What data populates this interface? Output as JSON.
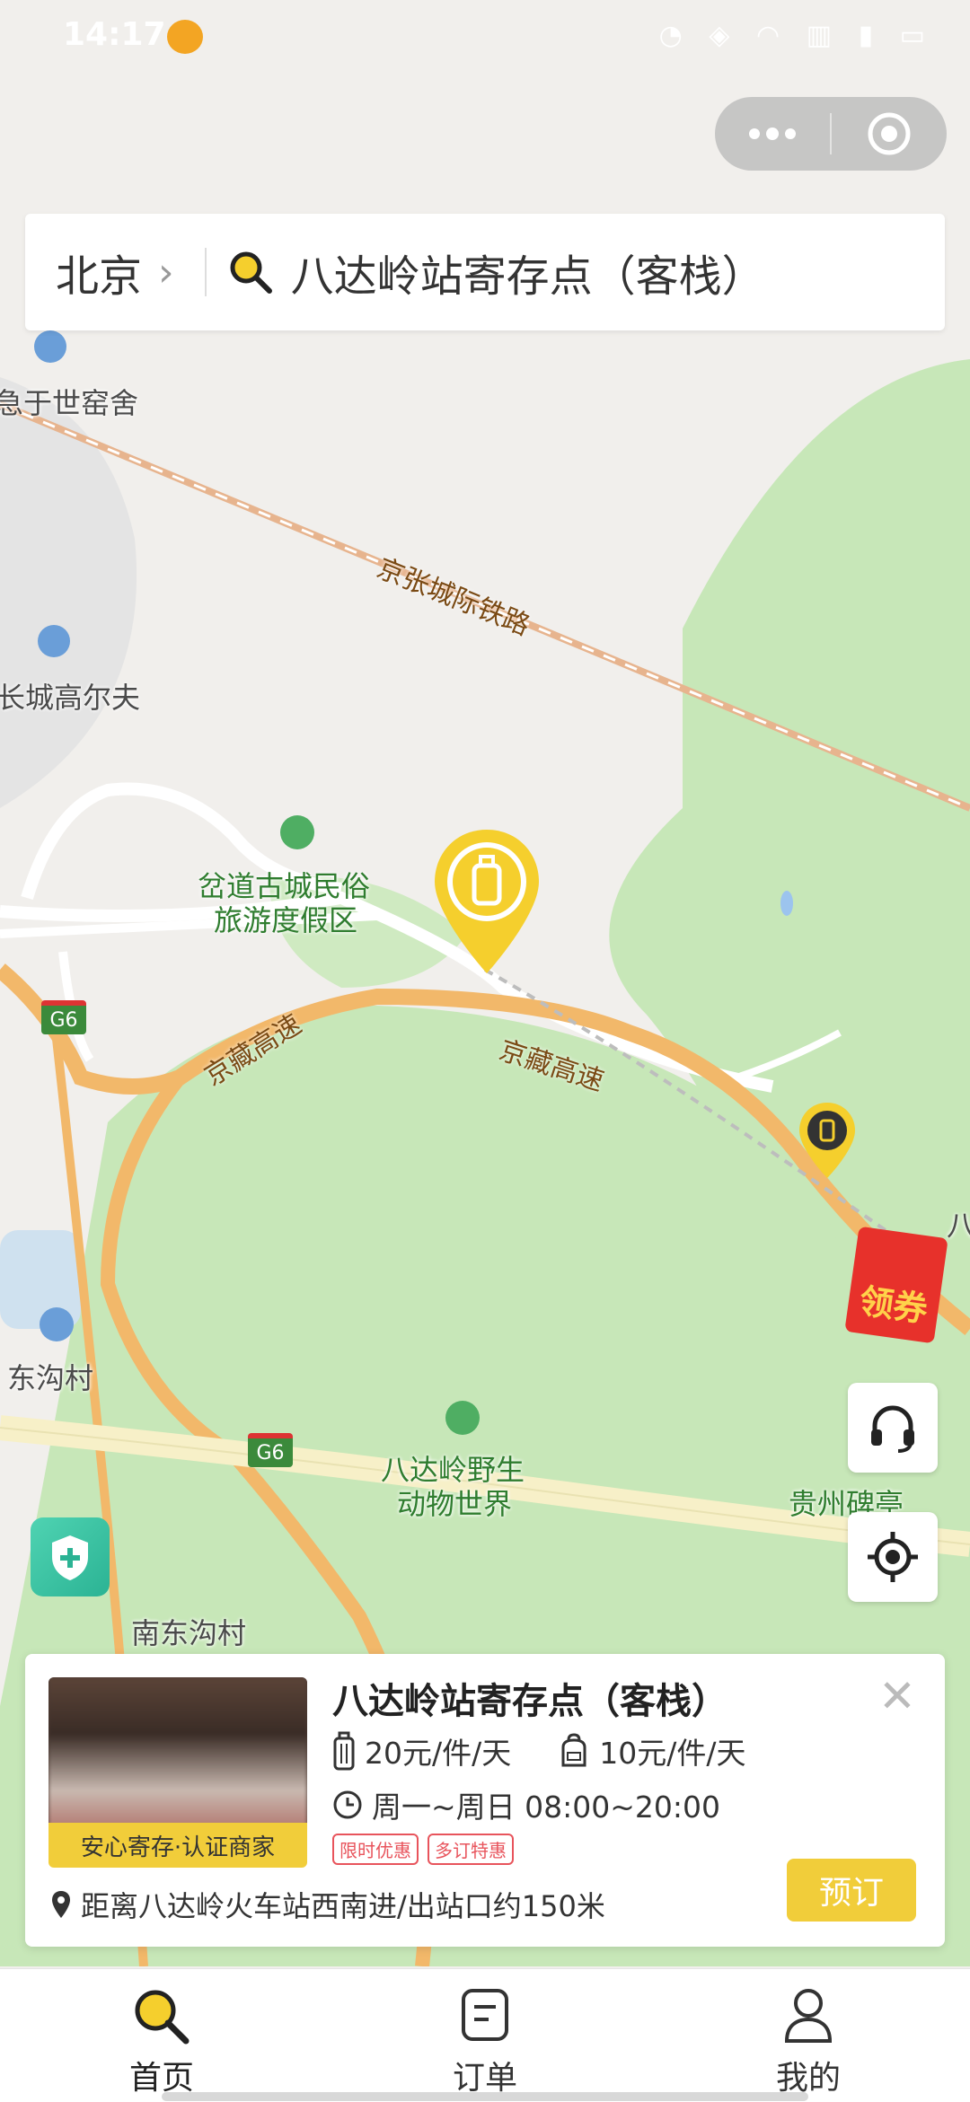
{
  "status_bar": {
    "time": "14:17",
    "icons": [
      "weibo-icon",
      "alarm-icon",
      "location-icon",
      "wifi-icon",
      "hd-icon",
      "signal-icon",
      "signal-icon",
      "battery-icon"
    ]
  },
  "capsule": {
    "more": "more-icon",
    "close": "target-icon"
  },
  "search": {
    "city": "北京",
    "query": "八达岭站寄存点（客栈）"
  },
  "map": {
    "labels": {
      "hotel": "急于世窑舍",
      "railway": "京张城际铁路",
      "golf": "长城高尔夫",
      "resort_line1": "岔道古城民俗",
      "resort_line2": "旅游度假区",
      "expressway_a": "京藏高速",
      "expressway_b": "京藏高速",
      "g6_a": "G6",
      "g6_b": "G6",
      "village_1": "东沟村",
      "village_2": "南东沟村",
      "zoo_line1": "八达岭野生",
      "zoo_line2": "动物世界",
      "pavilion": "贵州碑亭",
      "edge": "八"
    },
    "coupon": "领券"
  },
  "card": {
    "title": "八达岭站寄存点（客栈）",
    "badge": "安心寄存·认证商家",
    "price_large": "20元/件/天",
    "price_small": "10元/件/天",
    "hours": "周一~周日 08:00~20:00",
    "tags": [
      "限时优惠",
      "多订特惠"
    ],
    "distance": "距离八达岭火车站西南进/出站口约150米",
    "book": "预订"
  },
  "tabbar": {
    "tabs": [
      {
        "label": "首页",
        "icon": "search-icon"
      },
      {
        "label": "订单",
        "icon": "order-icon"
      },
      {
        "label": "我的",
        "icon": "user-icon"
      }
    ]
  }
}
